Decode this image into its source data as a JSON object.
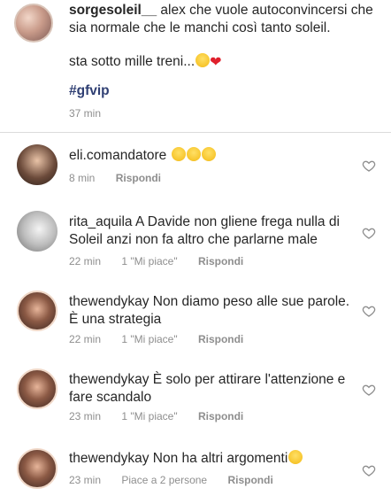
{
  "caption": {
    "username": "sorgesoleil__",
    "text": "alex che vuole autoconvincersi che sia normale che le manchi così tanto soleil.",
    "text_line2": "sta sotto mille treni...",
    "hashtag": "#gfvip",
    "time": "37 min"
  },
  "comments": [
    {
      "username": "eli.comandatore",
      "text": "",
      "emoji_count": 3,
      "time": "8 min",
      "likes": "",
      "reply_label": "Rispondi"
    },
    {
      "username": "rita_aquila",
      "text": "A Davide non gliene frega nulla di Soleil anzi non fa altro che parlarne male",
      "time": "22 min",
      "likes": "1 \"Mi piace\"",
      "reply_label": "Rispondi"
    },
    {
      "username": "thewendykay",
      "text": "Non diamo peso alle sue parole. È una strategia",
      "time": "22 min",
      "likes": "1 \"Mi piace\"",
      "reply_label": "Rispondi"
    },
    {
      "username": "thewendykay",
      "text": "È solo per attirare l'attenzione e fare scandalo",
      "time": "23 min",
      "likes": "1 \"Mi piace\"",
      "reply_label": "Rispondi"
    },
    {
      "username": "thewendykay",
      "text": "Non ha altri argomenti",
      "time": "23 min",
      "likes": "Piace a 2 persone",
      "reply_label": "Rispondi"
    }
  ],
  "icons": {
    "like": "heart-outline-icon"
  },
  "colors": {
    "hashtag": "#2f3f73",
    "meta": "#8e8e8e",
    "text": "#262626"
  }
}
